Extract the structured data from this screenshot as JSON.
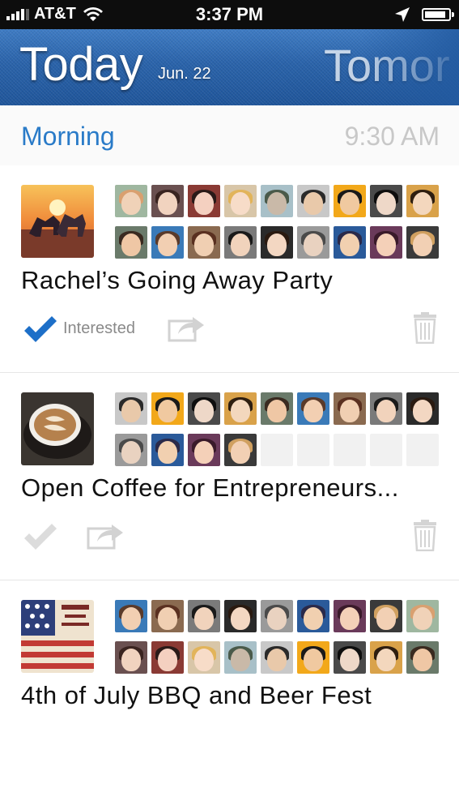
{
  "status_bar": {
    "carrier": "AT&T",
    "time": "3:37 PM",
    "battery_level": 0.9
  },
  "header": {
    "title": "Today",
    "date": "Jun. 22",
    "next_title": "Tomor"
  },
  "section": {
    "label": "Morning",
    "time": "9:30 AM"
  },
  "colors": {
    "accent": "#2a7bc8",
    "header_blue": "#2a63aa",
    "check_blue": "#1d6fc8",
    "muted_gray": "#cccccc"
  },
  "events": [
    {
      "title": "Rachel’s Going Away Party",
      "interested_label": "Interested",
      "interested": true,
      "attendee_slots": 18,
      "attendees_shown": 18
    },
    {
      "title": "Open Coffee for Entrepreneurs...",
      "interested_label": "",
      "interested": false,
      "attendee_slots": 18,
      "attendees_shown": 13
    },
    {
      "title": "4th of July BBQ and Beer Fest",
      "interested_label": "",
      "interested": false,
      "attendee_slots": 18,
      "attendees_shown": 18
    }
  ],
  "icons": {
    "check": "checkmark-icon",
    "share": "share-icon",
    "trash": "trash-icon",
    "location": "location-arrow-icon",
    "wifi": "wifi-icon",
    "battery": "battery-icon"
  }
}
